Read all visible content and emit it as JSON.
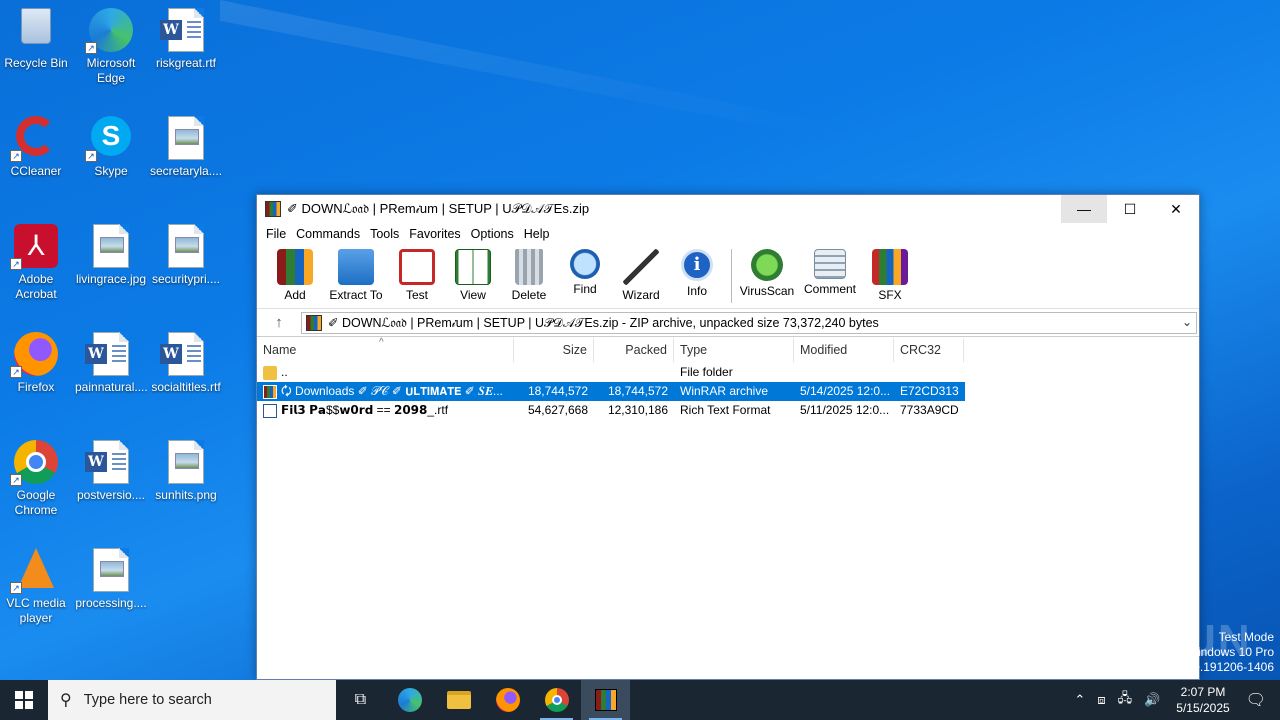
{
  "desktop": {
    "icons": [
      {
        "label": "Recycle Bin",
        "icon": "recycle-bin-icon"
      },
      {
        "label": "Microsoft Edge",
        "icon": "edge-icon"
      },
      {
        "label": "riskgreat.rtf",
        "icon": "word-doc-icon"
      },
      {
        "label": "CCleaner",
        "icon": "ccleaner-icon"
      },
      {
        "label": "Skype",
        "icon": "skype-icon"
      },
      {
        "label": "secretaryla....",
        "icon": "image-file-icon"
      },
      {
        "label": "Adobe Acrobat",
        "icon": "acrobat-icon"
      },
      {
        "label": "livingrace.jpg",
        "icon": "image-file-icon"
      },
      {
        "label": "securitypri....",
        "icon": "image-file-icon"
      },
      {
        "label": "Firefox",
        "icon": "firefox-icon"
      },
      {
        "label": "painnatural....",
        "icon": "word-doc-icon"
      },
      {
        "label": "socialtitles.rtf",
        "icon": "word-doc-icon"
      },
      {
        "label": "Google Chrome",
        "icon": "chrome-icon"
      },
      {
        "label": "postversio....",
        "icon": "word-doc-icon"
      },
      {
        "label": "sunhits.png",
        "icon": "image-file-icon"
      },
      {
        "label": "VLC media player",
        "icon": "vlc-icon"
      },
      {
        "label": "processing....",
        "icon": "image-file-icon"
      }
    ]
  },
  "window": {
    "title": "✐ DOWNℒ𝔬𝔞𝔡 | PRem𝒾um | SΕTUP | U𝒫𝒟𝒜𝒯Es.zip",
    "min_label": "—",
    "max_label": "☐",
    "close_label": "✕",
    "menu": [
      "File",
      "Commands",
      "Tools",
      "Favorites",
      "Options",
      "Help"
    ],
    "toolbar": [
      {
        "label": "Add",
        "icon": "add-archive-icon"
      },
      {
        "label": "Extract To",
        "icon": "extract-folder-icon"
      },
      {
        "label": "Test",
        "icon": "test-checklist-icon"
      },
      {
        "label": "View",
        "icon": "view-book-icon"
      },
      {
        "label": "Delete",
        "icon": "delete-trash-icon"
      },
      {
        "label": "Find",
        "icon": "find-magnifier-icon"
      },
      {
        "label": "Wizard",
        "icon": "wizard-wand-icon"
      },
      {
        "label": "Info",
        "icon": "info-icon"
      },
      {
        "label": "VirusScan",
        "icon": "virusscan-bug-icon"
      },
      {
        "label": "Comment",
        "icon": "comment-icon"
      },
      {
        "label": "SFX",
        "icon": "sfx-books-icon"
      }
    ],
    "address": "✐ DOWNℒ𝔬𝔞𝔡 | PRem𝒾um | SΕTUP | U𝒫𝒟𝒜𝒯Es.zip - ZIP archive, unpacked size 73,372,240 bytes",
    "columns": {
      "name": "Name",
      "size": "Size",
      "packed": "Packed",
      "type": "Type",
      "modified": "Modified",
      "crc": "CRC32"
    },
    "rows": [
      {
        "name": "..",
        "size": "",
        "packed": "",
        "type": "File folder",
        "modified": "",
        "crc": "",
        "icon": "folder-icon"
      },
      {
        "name": "🗘 Downloads ✐ 𝒫𝒞 ✐ 𝗨𝗟𝗧𝗜𝗠𝗔𝗧𝗘 ✐ 𝑺𝑬...",
        "size": "18,744,572",
        "packed": "18,744,572",
        "type": "WinRAR archive",
        "modified": "5/14/2025 12:0...",
        "crc": "E72CD313",
        "icon": "rar-archive-icon"
      },
      {
        "name": "𝗙𝗶𝗹𝟯 𝗣𝗮$$𝘄𝟬𝗿𝗱 == 𝟮𝟬𝟵𝟴_.rtf",
        "size": "54,627,668",
        "packed": "12,310,186",
        "type": "Rich Text Format",
        "modified": "5/11/2025 12:0...",
        "crc": "7733A9CD",
        "icon": "rtf-doc-icon"
      }
    ]
  },
  "taskbar": {
    "search_placeholder": "Type here to search",
    "time": "2:07 PM",
    "date": "5/15/2025"
  },
  "watermark": {
    "line1": "Test Mode",
    "line2": "indows 10 Pro",
    "line3": "e.191206-1406",
    "brand": "ANY RUN"
  }
}
